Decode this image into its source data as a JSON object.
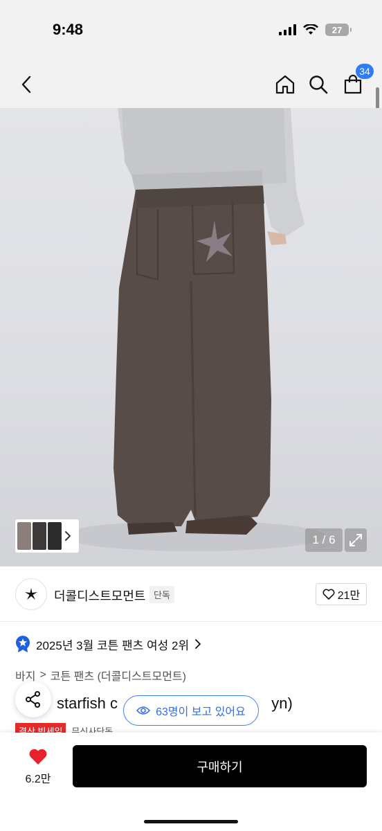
{
  "status_bar": {
    "time": "9:48",
    "battery": "27"
  },
  "nav": {
    "cart_count": "34"
  },
  "gallery": {
    "counter": "1 / 6"
  },
  "brand": {
    "name": "더콜디스트모먼트",
    "exclusive_tag": "단독",
    "likes": "21만"
  },
  "ranking": {
    "text": "2025년 3월 코튼 팬츠 여성 2위"
  },
  "breadcrumb": {
    "category": "바지",
    "separator": ">",
    "subcategory": "코튼 팬츠 (더콜디스트모먼트)"
  },
  "product": {
    "title": "starfish c",
    "title_tail": "yn)",
    "sale_tag": "결산 빅세일",
    "store_tag": "무신사단독"
  },
  "viewers": {
    "text": "63명이 보고 있어요"
  },
  "bottom_bar": {
    "likes": "6.2만",
    "buy_label": "구매하기"
  },
  "colors": {
    "accent_blue": "#2f7cf6",
    "sale_red": "#e52a2a",
    "heart_red": "#e8222c",
    "buy_black": "#000000"
  }
}
